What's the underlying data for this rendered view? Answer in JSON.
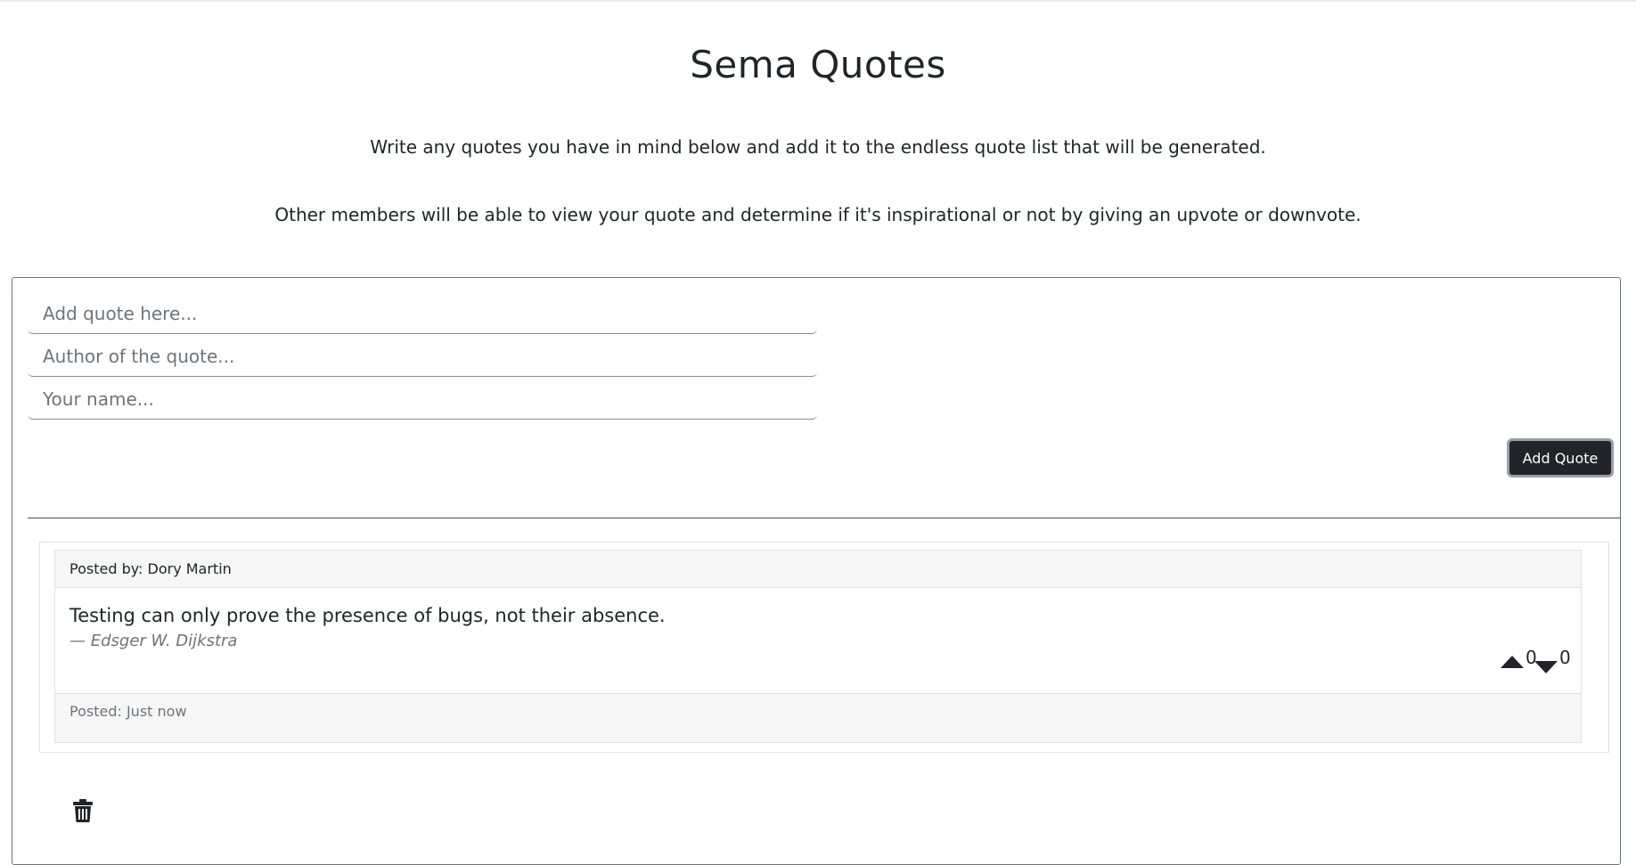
{
  "page": {
    "title": "Sema Quotes",
    "intro_line_1": "Write any quotes you have in mind below and add it to the endless quote list that will be generated.",
    "intro_line_2": "Other members will be able to view your quote and determine if it's inspirational or not by giving an upvote or downvote."
  },
  "form": {
    "quote_placeholder": "Add quote here...",
    "author_placeholder": "Author of the quote...",
    "name_placeholder": "Your name...",
    "quote_value": "",
    "author_value": "",
    "name_value": "",
    "submit_label": "Add Quote"
  },
  "quotes": [
    {
      "posted_by": "Posted by: Dory Martin",
      "text": "Testing can only prove the presence of bugs, not their absence.",
      "author": "— Edsger W. Dijkstra",
      "upvotes": "0",
      "downvotes": "0",
      "posted_time": "Posted: Just now"
    }
  ],
  "icons": {
    "upvote": "triangle-up-icon",
    "downvote": "triangle-down-icon",
    "delete": "trash-icon"
  },
  "colors": {
    "button_bg": "#212529",
    "card_header_bg": "#f6f6f6"
  }
}
